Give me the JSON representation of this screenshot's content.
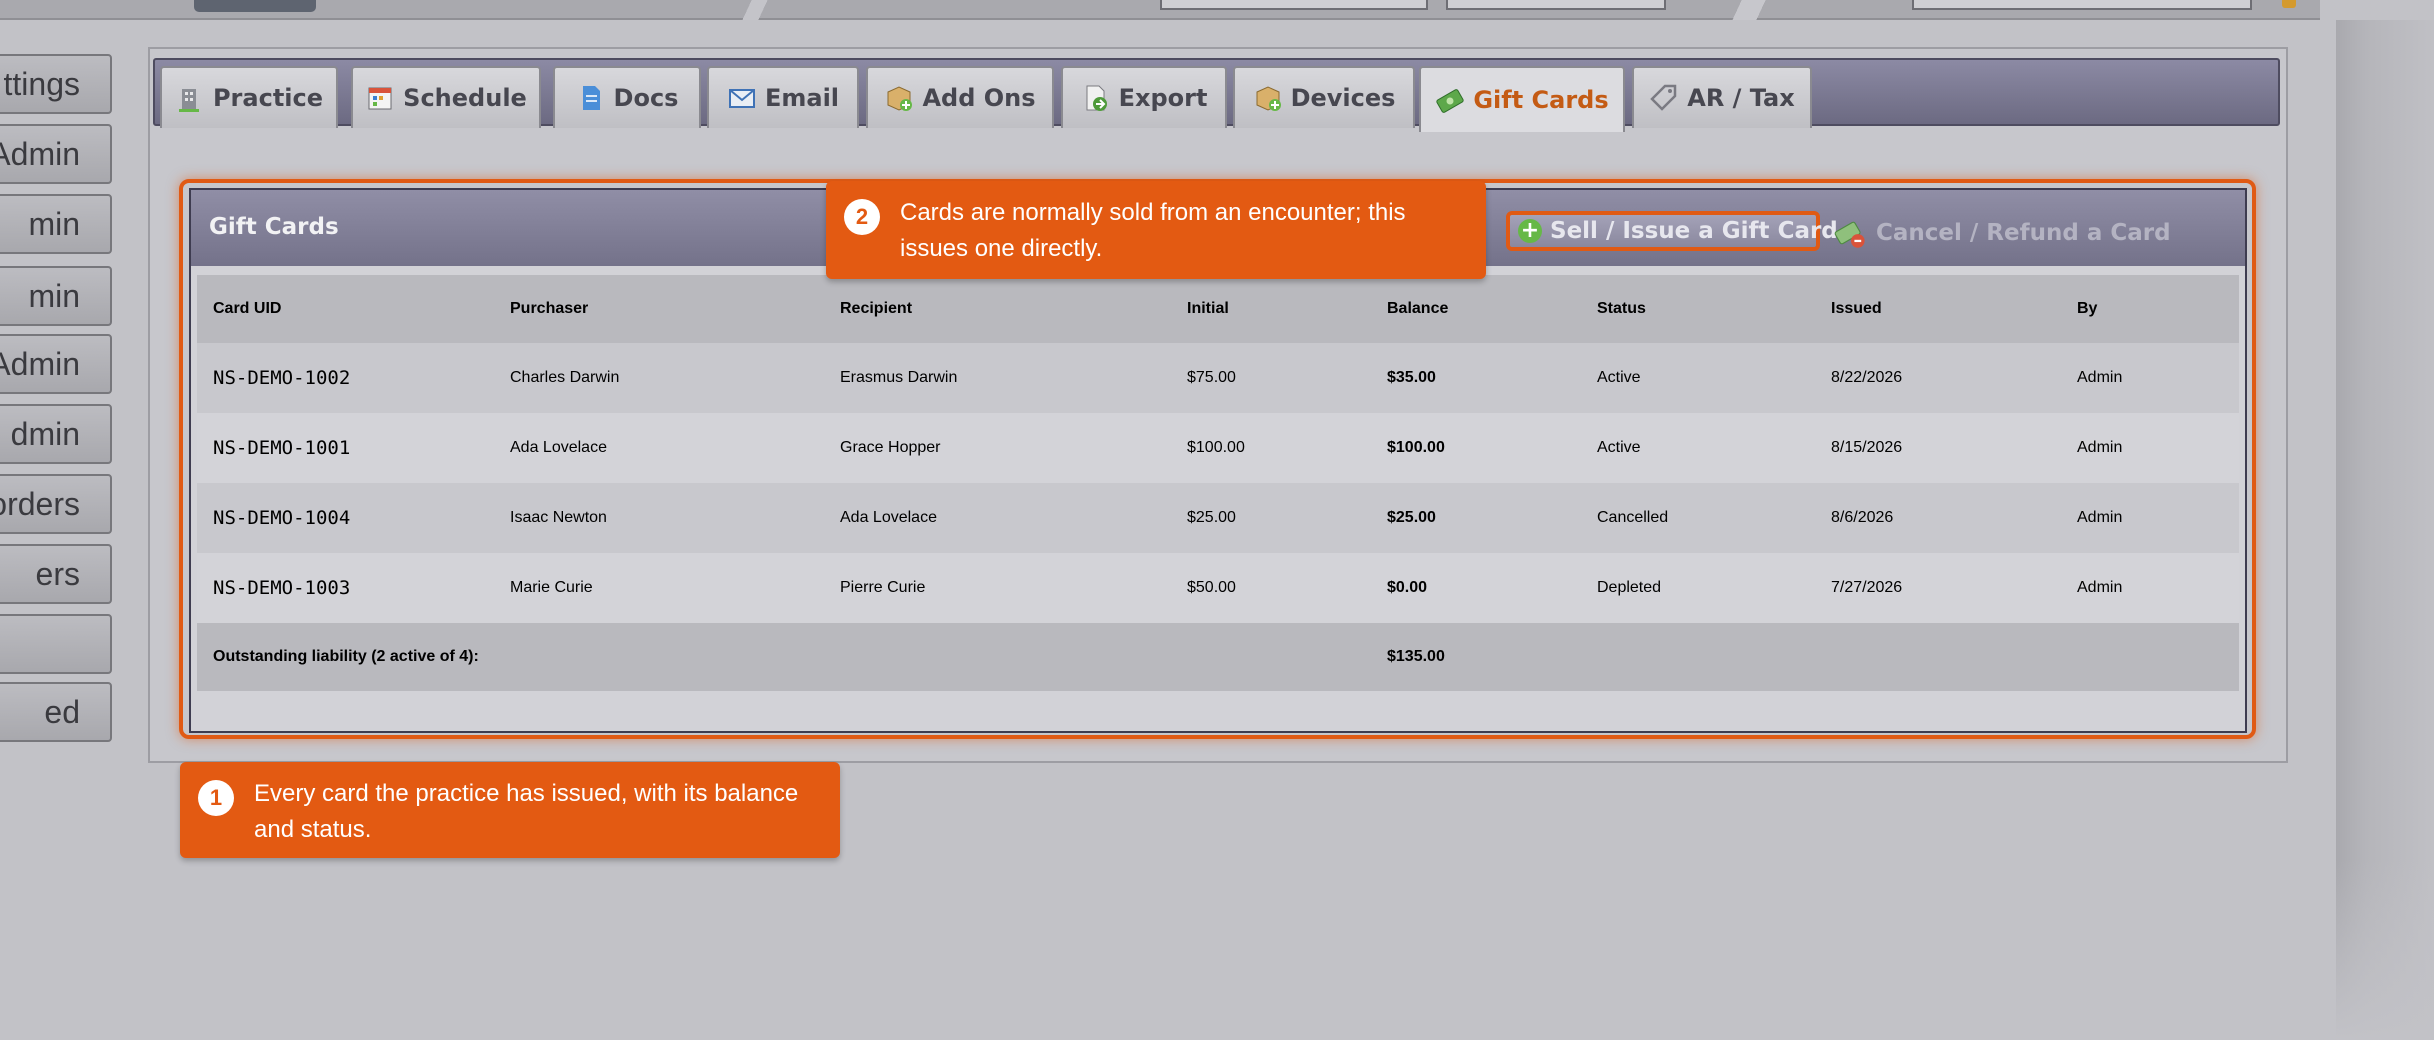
{
  "topbar": {
    "label": ""
  },
  "sidebar": {
    "items": [
      {
        "label": "ttings"
      },
      {
        "label": "Admin"
      },
      {
        "label": "min"
      },
      {
        "label": "min"
      },
      {
        "label": "Admin"
      },
      {
        "label": "dmin"
      },
      {
        "label": "orders"
      },
      {
        "label": "ers"
      },
      {
        "label": ""
      },
      {
        "label": "ed"
      }
    ]
  },
  "tabs": [
    {
      "label": "Practice",
      "icon": "building-icon"
    },
    {
      "label": "Schedule",
      "icon": "calendar-icon"
    },
    {
      "label": "Docs",
      "icon": "document-icon"
    },
    {
      "label": "Email",
      "icon": "envelope-icon"
    },
    {
      "label": "Add Ons",
      "icon": "package-plus-icon"
    },
    {
      "label": "Export",
      "icon": "export-icon"
    },
    {
      "label": "Devices",
      "icon": "package-plus-icon"
    },
    {
      "label": "Gift Cards",
      "icon": "money-icon",
      "active": true
    },
    {
      "label": "AR / Tax",
      "icon": "tag-icon"
    }
  ],
  "gift_cards": {
    "title": "Gift Cards",
    "sell_button": "Sell / Issue a Gift Card",
    "cancel_button": "Cancel / Refund a Card",
    "columns": [
      "Card UID",
      "Purchaser",
      "Recipient",
      "Initial",
      "Balance",
      "Status",
      "Issued",
      "By"
    ],
    "rows": [
      {
        "uid": "NS-DEMO-1002",
        "purchaser": "Charles Darwin",
        "recipient": "Erasmus Darwin",
        "initial": "$75.00",
        "balance": "$35.00",
        "status": "Active",
        "issued": "8/22/2026",
        "by": "Admin"
      },
      {
        "uid": "NS-DEMO-1001",
        "purchaser": "Ada Lovelace",
        "recipient": "Grace Hopper",
        "initial": "$100.00",
        "balance": "$100.00",
        "status": "Active",
        "issued": "8/15/2026",
        "by": "Admin"
      },
      {
        "uid": "NS-DEMO-1004",
        "purchaser": "Isaac Newton",
        "recipient": "Ada Lovelace",
        "initial": "$25.00",
        "balance": "$25.00",
        "status": "Cancelled",
        "issued": "8/6/2026",
        "by": "Admin"
      },
      {
        "uid": "NS-DEMO-1003",
        "purchaser": "Marie Curie",
        "recipient": "Pierre Curie",
        "initial": "$50.00",
        "balance": "$0.00",
        "status": "Depleted",
        "issued": "7/27/2026",
        "by": "Admin"
      }
    ],
    "footer_label": "Outstanding liability (2 active of 4):",
    "footer_total": "$135.00"
  },
  "callouts": [
    {
      "number": "1",
      "text": "Every card the practice has issued, with its balance and status."
    },
    {
      "number": "2",
      "text": "Cards are normally sold from an encounter; this issues one directly."
    }
  ],
  "colors": {
    "accent": "#e35a12",
    "active_tab_text": "#c45b14",
    "header": "#7e7c94"
  }
}
